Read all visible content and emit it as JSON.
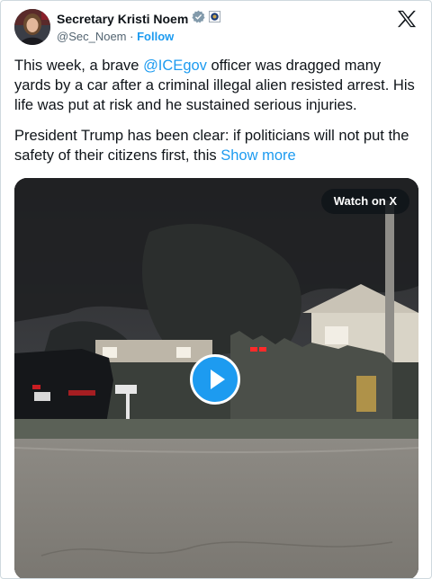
{
  "author": {
    "display_name": "Secretary Kristi Noem",
    "handle": "@Sec_Noem",
    "separator": "·",
    "follow_label": "Follow"
  },
  "tweet": {
    "p1_start": "This week, a brave ",
    "p1_mention": "@ICEgov",
    "p1_end": " officer was dragged many yards by a car after a criminal illegal alien resisted arrest. His life was put at risk and he sustained serious injuries.",
    "p2_start": "President Trump has been clear: if politicians will not put the safety of their citizens first, this ",
    "show_more": "Show more"
  },
  "media": {
    "watch_label": "Watch on X"
  },
  "colors": {
    "accent": "#1d9bf0",
    "text": "#0f1419",
    "muted": "#536471"
  },
  "icons": {
    "verified": "verified-badge-icon",
    "affiliate": "government-seal-icon",
    "platform": "x-logo-icon",
    "play": "play-icon"
  }
}
